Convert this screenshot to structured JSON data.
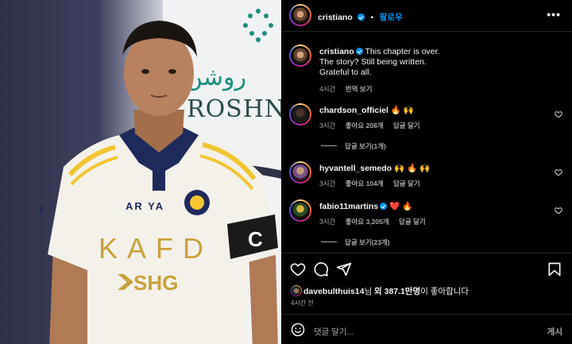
{
  "header": {
    "username": "cristiano",
    "follow_label": "팔로우",
    "separator": "•",
    "more_label": "•••"
  },
  "caption": {
    "username": "cristiano",
    "lines": [
      "This chapter is over.",
      "The story? Still being written.",
      "Grateful to all."
    ],
    "time": "4시간",
    "translate": "번역 보기"
  },
  "comments": [
    {
      "username": "chardson_officiel",
      "emoji": "🔥 🙌",
      "verified": false,
      "time": "3시간",
      "likes": "좋아요 208개",
      "reply": "답글 달기",
      "replies": "답글 보기(1개)"
    },
    {
      "username": "hyvantell_semedo",
      "emoji": "🙌 🔥 🙌",
      "verified": false,
      "time": "3시간",
      "likes": "좋아요 104개",
      "reply": "답글 달기",
      "replies": ""
    },
    {
      "username": "fabio11martins",
      "emoji": "❤️ 🔥",
      "verified": true,
      "time": "3시간",
      "likes": "좋아요 3,205개",
      "reply": "답글 달기",
      "replies": "답글 보기(23개)"
    }
  ],
  "likes": {
    "user": "davebulthuis14",
    "suffix_1": "님 ",
    "bold": "외 387.1만명",
    "suffix_2": "이 좋아합니다"
  },
  "post_time": "4시간 전",
  "comment_input": {
    "placeholder": "댓글 달기...",
    "post_label": "게시"
  },
  "photo": {
    "board_text_ar": "روشن",
    "board_text_en": "ROSHN",
    "jersey_sponsor": "KAFD",
    "jersey_sponsor2": "SHG",
    "jersey_brand": "AR YA"
  },
  "colors": {
    "accent": "#0095f6",
    "bg": "#000000",
    "muted": "#a8a8a8",
    "heart": "#ed4956"
  }
}
